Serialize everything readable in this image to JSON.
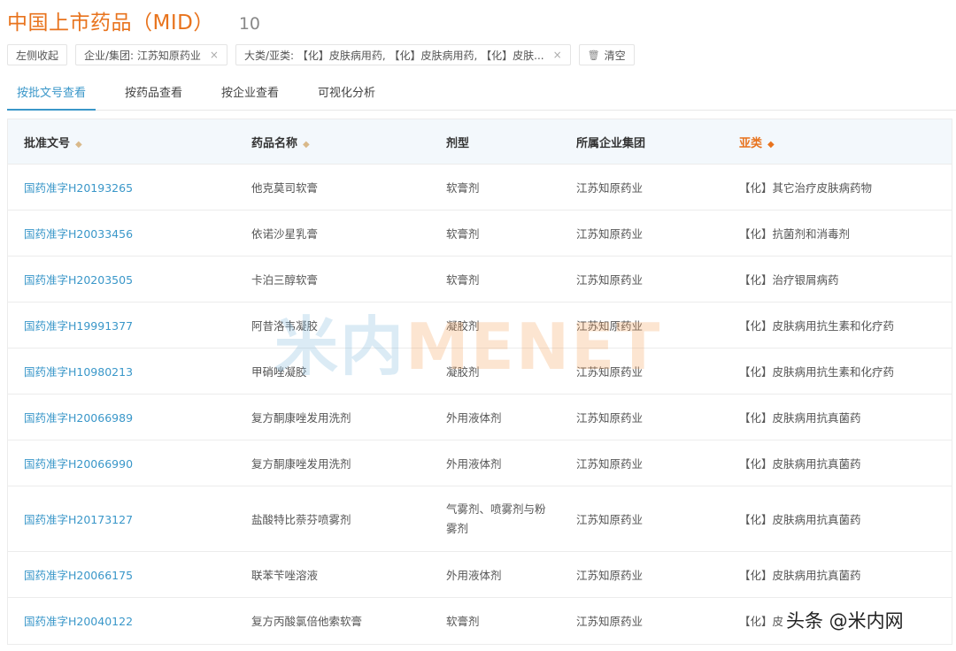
{
  "header": {
    "title": "中国上市药品（MID）",
    "count": "10"
  },
  "filters": {
    "collapse": "左侧收起",
    "enterprise": "企业/集团: 江苏知原药业",
    "category": "大类/亚类: 【化】皮肤病用药, 【化】皮肤病用药, 【化】皮肤...",
    "clear": "清空",
    "close_glyph": "×",
    "trash_glyph": "🗑"
  },
  "tabs": [
    "按批文号查看",
    "按药品查看",
    "按企业查看",
    "可视化分析"
  ],
  "table": {
    "headers": [
      "批准文号",
      "药品名称",
      "剂型",
      "所属企业集团",
      "亚类"
    ],
    "rows": [
      [
        "国药准字H20193265",
        "他克莫司软膏",
        "软膏剂",
        "江苏知原药业",
        "【化】其它治疗皮肤病药物"
      ],
      [
        "国药准字H20033456",
        "依诺沙星乳膏",
        "软膏剂",
        "江苏知原药业",
        "【化】抗菌剂和消毒剂"
      ],
      [
        "国药准字H20203505",
        "卡泊三醇软膏",
        "软膏剂",
        "江苏知原药业",
        "【化】治疗银屑病药"
      ],
      [
        "国药准字H19991377",
        "阿昔洛韦凝胶",
        "凝胶剂",
        "江苏知原药业",
        "【化】皮肤病用抗生素和化疗药"
      ],
      [
        "国药准字H10980213",
        "甲硝唑凝胶",
        "凝胶剂",
        "江苏知原药业",
        "【化】皮肤病用抗生素和化疗药"
      ],
      [
        "国药准字H20066989",
        "复方酮康唑发用洗剂",
        "外用液体剂",
        "江苏知原药业",
        "【化】皮肤病用抗真菌药"
      ],
      [
        "国药准字H20066990",
        "复方酮康唑发用洗剂",
        "外用液体剂",
        "江苏知原药业",
        "【化】皮肤病用抗真菌药"
      ],
      [
        "国药准字H20173127",
        "盐酸特比萘芬喷雾剂",
        "气雾剂、喷雾剂与粉雾剂",
        "江苏知原药业",
        "【化】皮肤病用抗真菌药"
      ],
      [
        "国药准字H20066175",
        "联苯苄唑溶液",
        "外用液体剂",
        "江苏知原药业",
        "【化】皮肤病用抗真菌药"
      ],
      [
        "国药准字H20040122",
        "复方丙酸氯倍他索软膏",
        "软膏剂",
        "江苏知原药业",
        "【化】皮"
      ]
    ]
  },
  "watermark": {
    "part1": "米内",
    "part2": "MENET"
  },
  "attribution": "头条 @米内网",
  "colors": {
    "accent_orange": "#e8731d",
    "link_blue": "#3a97c9",
    "header_bg": "#f3f8fc"
  }
}
